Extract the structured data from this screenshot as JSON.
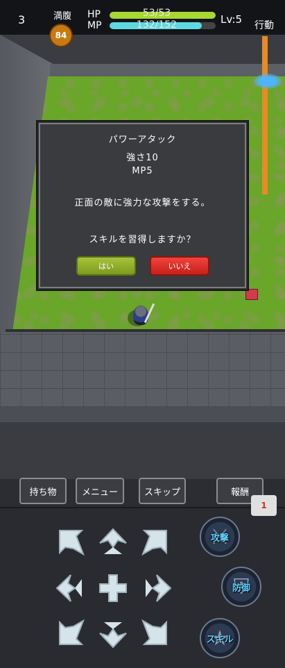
{
  "hud": {
    "floor": "3",
    "hunger_label": "満腹",
    "hunger_value": "84",
    "hp_label": "HP",
    "hp_text": "53/53",
    "hp_fraction": 1.0,
    "mp_label": "MP",
    "mp_text": "132/152",
    "mp_fraction": 0.87,
    "level": "Lv:5",
    "action_label": "行動",
    "colors": {
      "hp": "#a8d832",
      "mp": "#5fd8e0",
      "hunger": "#c87a12"
    }
  },
  "dialog": {
    "skill_name": "パワーアタック",
    "power": "強さ10",
    "cost": "MP5",
    "description": "正面の敵に強力な攻撃をする。",
    "question": "スキルを習得しますか？",
    "yes_label": "はい",
    "no_label": "いいえ"
  },
  "menu": {
    "items_label": "持ち物",
    "menu_label": "メニュー",
    "skip_label": "スキップ",
    "reward_label": "報酬",
    "reward_badge": "1"
  },
  "controls": {
    "dpad_icons": [
      "arrow-up-left-icon",
      "arrow-up-icon",
      "arrow-up-right-icon",
      "arrow-left-icon",
      "plus-icon",
      "arrow-right-icon",
      "arrow-down-left-icon",
      "arrow-down-icon",
      "arrow-down-right-icon"
    ],
    "attack_label": "攻撃",
    "defend_label": "防御",
    "skill_label": "スキル"
  }
}
